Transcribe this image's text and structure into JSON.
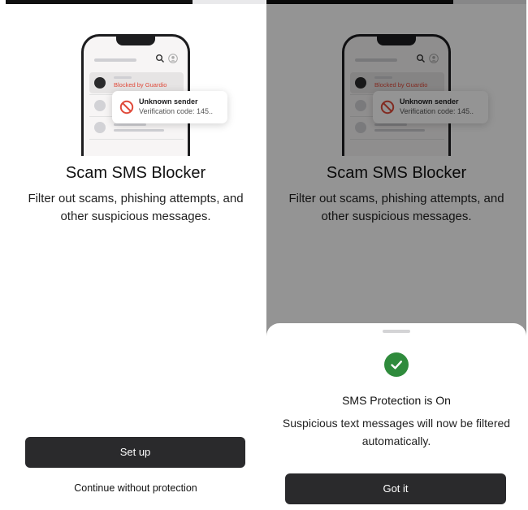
{
  "left_screen": {
    "progress": 0.72,
    "mockup": {
      "blocked_label": "Blocked by Guardio",
      "notification_title": "Unknown sender",
      "notification_text": "Verification code: 145.."
    },
    "title": "Scam SMS Blocker",
    "description": "Filter out scams, phishing attempts, and other suspicious messages.",
    "primary_button": "Set up",
    "secondary_button": "Continue without protection"
  },
  "right_screen": {
    "progress": 0.72,
    "mockup": {
      "blocked_label": "Blocked by Guardio",
      "notification_title": "Unknown sender",
      "notification_text": "Verification code: 145.."
    },
    "title": "Scam SMS Blocker",
    "description": "Filter out scams, phishing attempts, and other suspicious messages.",
    "sheet": {
      "icon": "check-circle-icon",
      "title": "SMS Protection is On",
      "description": "Suspicious text messages will now be filtered automatically.",
      "button": "Got it"
    }
  },
  "colors": {
    "button": "#2a2a2c",
    "blocked_red": "#e04a3a",
    "success_green": "#2f8b3c"
  }
}
